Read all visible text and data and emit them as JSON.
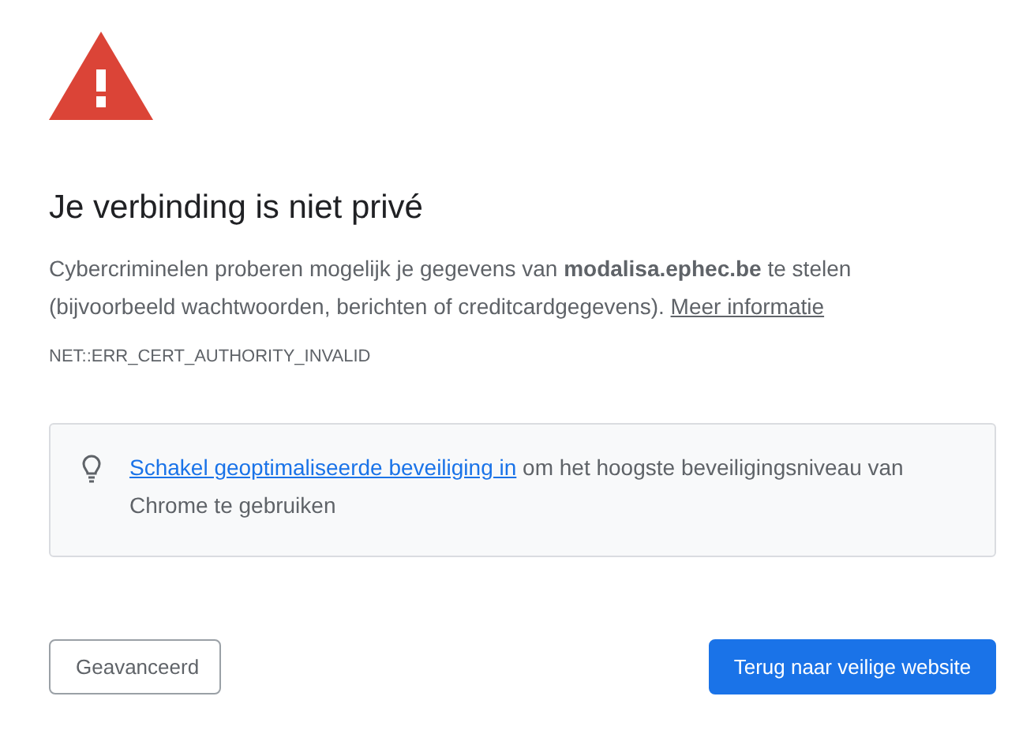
{
  "heading": "Je verbinding is niet privé",
  "message": {
    "text": "Cybercriminelen proberen mogelijk je gegevens van **modalisa.ephec.be** te stelen (bijvoorbeeld wachtwoorden, berichten of creditcardgegevens).",
    "link": "Meer informatie"
  },
  "error_code": "NET::ERR_CERT_AUTHORITY_INVALID",
  "tip": {
    "link": "Schakel geoptimaliseerde beveiliging in",
    "text": "om het hoogste beveiligingsniveau van Chrome te gebruiken"
  },
  "buttons": [
    {
      "label": "Geavanceerd",
      "kind": "secondary"
    },
    {
      "label": "Terug naar veilige website",
      "kind": "primary"
    }
  ]
}
